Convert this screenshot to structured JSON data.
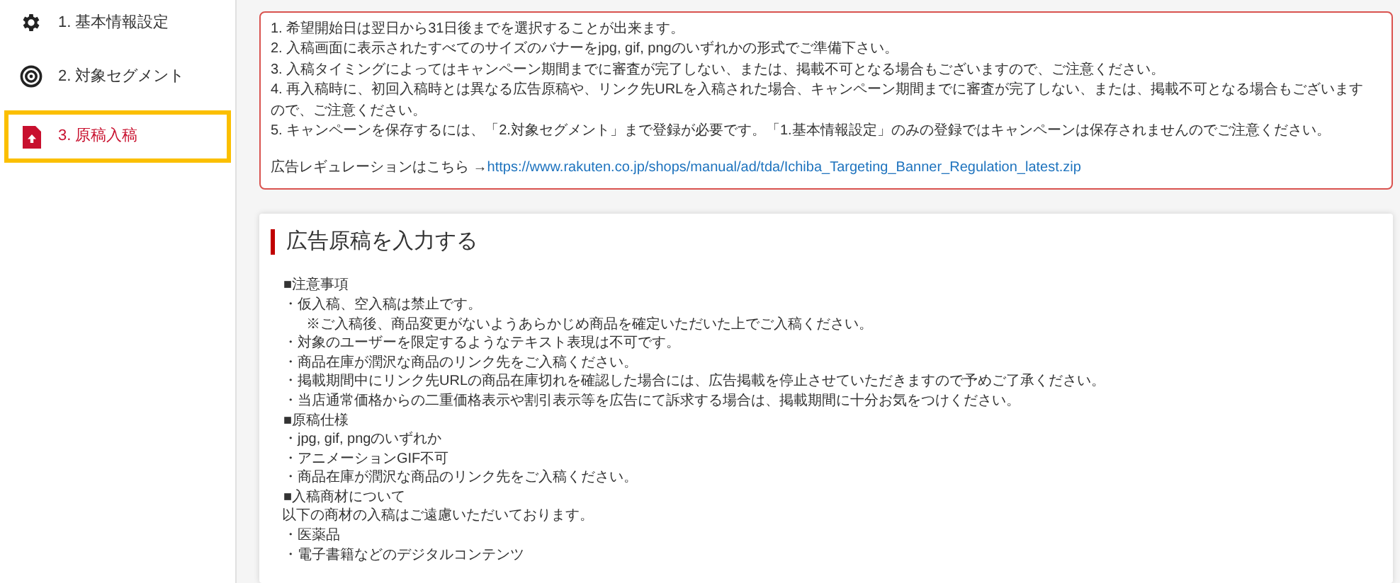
{
  "sidebar": {
    "items": [
      {
        "label": "1. 基本情報設定",
        "kind": "gear",
        "selected": false
      },
      {
        "label": "2. 対象セグメント",
        "kind": "target",
        "selected": false
      },
      {
        "label": "3. 原稿入稿",
        "kind": "file",
        "selected": true
      }
    ]
  },
  "notice": {
    "items": [
      "1. 希望開始日は翌日から31日後までを選択することが出来ます。",
      "2. 入稿画面に表示されたすべてのサイズのバナーをjpg, gif, pngのいずれかの形式でご準備下さい。",
      "3. 入稿タイミングによってはキャンペーン期間までに審査が完了しない、または、掲載不可となる場合もございますので、ご注意ください。",
      "4. 再入稿時に、初回入稿時とは異なる広告原稿や、リンク先URLを入稿された場合、キャンペーン期間までに審査が完了しない、または、掲載不可となる場合もございますので、ご注意ください。",
      "5. キャンペーンを保存するには、「2.対象セグメント」まで登録が必要です。「1.基本情報設定」のみの登録ではキャンペーンは保存されませんのでご注意ください。"
    ],
    "regulation_label": "広告レギュレーションはこちら →",
    "regulation_link": "https://www.rakuten.co.jp/shops/manual/ad/tda/Ichiba_Targeting_Banner_Regulation_latest.zip"
  },
  "card": {
    "title": "広告原稿を入力する",
    "lines": [
      {
        "kind": "section",
        "text": "■注意事項"
      },
      {
        "kind": "item",
        "text": "・仮入稿、空入稿は禁止です。"
      },
      {
        "kind": "subnote",
        "text": "※ご入稿後、商品変更がないようあらかじめ商品を確定いただいた上でご入稿ください。"
      },
      {
        "kind": "item",
        "text": "・対象のユーザーを限定するようなテキスト表現は不可です。"
      },
      {
        "kind": "item",
        "text": "・商品在庫が潤沢な商品のリンク先をご入稿ください。"
      },
      {
        "kind": "item",
        "text": "・掲載期間中にリンク先URLの商品在庫切れを確認した場合には、広告掲載を停止させていただきますので予めご了承ください。"
      },
      {
        "kind": "item",
        "text": "・当店通常価格からの二重価格表示や割引表示等を広告にて訴求する場合は、掲載期間に十分お気をつけください。"
      },
      {
        "kind": "section",
        "text": "■原稿仕様"
      },
      {
        "kind": "item",
        "text": "・jpg, gif, pngのいずれか"
      },
      {
        "kind": "item",
        "text": "・アニメーションGIF不可"
      },
      {
        "kind": "item",
        "text": "・商品在庫が潤沢な商品のリンク先をご入稿ください。"
      },
      {
        "kind": "section",
        "text": "■入稿商材について"
      },
      {
        "kind": "text",
        "text": "以下の商材の入稿はご遠慮いただいております。"
      },
      {
        "kind": "item",
        "text": "・医薬品"
      },
      {
        "kind": "item",
        "text": "・電子書籍などのデジタルコンテンツ"
      }
    ]
  }
}
